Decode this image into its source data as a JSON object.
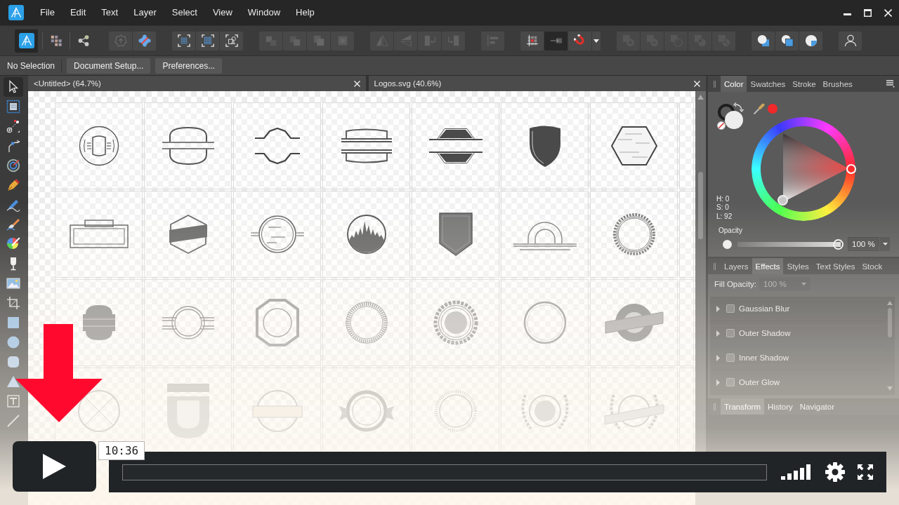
{
  "menu_bar": {
    "items": [
      "File",
      "Edit",
      "Text",
      "Layer",
      "Select",
      "View",
      "Window",
      "Help"
    ]
  },
  "toolbar": {
    "groups": [
      {
        "buttons": [
          {
            "selected": true,
            "disabled": false
          },
          {
            "selected": false,
            "disabled": false
          },
          {
            "selected": false,
            "disabled": false
          }
        ]
      },
      {
        "buttons": [
          {
            "selected": false,
            "disabled": true
          },
          {
            "selected": false,
            "disabled": false
          }
        ]
      },
      {
        "buttons": [
          {
            "selected": false,
            "disabled": false
          },
          {
            "selected": false,
            "disabled": false
          },
          {
            "selected": false,
            "disabled": false
          }
        ]
      },
      {
        "buttons": [
          {
            "selected": false,
            "disabled": true
          },
          {
            "selected": false,
            "disabled": true
          },
          {
            "selected": false,
            "disabled": true
          },
          {
            "selected": false,
            "disabled": true
          }
        ]
      },
      {
        "buttons": [
          {
            "selected": false,
            "disabled": true
          },
          {
            "selected": false,
            "disabled": true
          },
          {
            "selected": false,
            "disabled": true
          },
          {
            "selected": false,
            "disabled": true
          }
        ]
      },
      {
        "buttons": [
          {
            "selected": false,
            "disabled": true
          }
        ]
      },
      {
        "buttons": [
          {
            "selected": false,
            "disabled": false
          },
          {
            "selected": true,
            "disabled": false
          },
          {
            "selected": false,
            "disabled": false
          },
          {
            "selected": false,
            "disabled": false
          }
        ]
      },
      {
        "buttons": [
          {
            "selected": false,
            "disabled": true
          },
          {
            "selected": false,
            "disabled": true
          },
          {
            "selected": false,
            "disabled": true
          },
          {
            "selected": false,
            "disabled": true
          },
          {
            "selected": false,
            "disabled": true
          }
        ]
      },
      {
        "buttons": [
          {
            "selected": false,
            "disabled": false
          },
          {
            "selected": false,
            "disabled": false
          },
          {
            "selected": false,
            "disabled": false
          }
        ]
      },
      {
        "buttons": [
          {
            "selected": false,
            "disabled": false
          }
        ]
      }
    ]
  },
  "context_bar": {
    "status": "No Selection",
    "buttons": [
      "Document Setup...",
      "Preferences..."
    ]
  },
  "tools": [
    {
      "selected": true
    },
    {
      "selected": false
    },
    {
      "selected": false
    },
    {
      "selected": false
    },
    {
      "selected": false
    },
    {
      "selected": false
    },
    {
      "selected": false
    },
    {
      "selected": false
    },
    {
      "selected": false
    },
    {
      "selected": false
    },
    {
      "selected": false
    },
    {
      "selected": false
    },
    {
      "selected": false
    },
    {
      "selected": false
    },
    {
      "selected": false
    },
    {
      "selected": false
    },
    {
      "selected": false
    },
    {
      "selected": false
    }
  ],
  "documents": [
    {
      "title": "<Untitled> (64.7%)"
    },
    {
      "title": "Logos.svg (40.6%)"
    }
  ],
  "color_panel": {
    "tabs": [
      {
        "label": "Color",
        "selected": true
      },
      {
        "label": "Swatches",
        "selected": false
      },
      {
        "label": "Stroke",
        "selected": false
      },
      {
        "label": "Brushes",
        "selected": false
      }
    ],
    "readouts": [
      "H: 0",
      "S: 0",
      "L: 92"
    ],
    "opacity": {
      "label": "Opacity",
      "level": 1,
      "value": "100 %"
    }
  },
  "effects_panel": {
    "tabs": [
      {
        "label": "Layers",
        "selected": false
      },
      {
        "label": "Effects",
        "selected": true
      },
      {
        "label": "Styles",
        "selected": false
      },
      {
        "label": "Text Styles",
        "selected": false
      },
      {
        "label": "Stock",
        "selected": false
      }
    ],
    "fill_opacity": {
      "label": "Fill Opacity:",
      "value": "100 %",
      "disabled": true
    },
    "effects": [
      {
        "label": "Gaussian Blur",
        "expanded": false,
        "checked": false
      },
      {
        "label": "Outer Shadow",
        "expanded": false,
        "checked": false
      },
      {
        "label": "Inner Shadow",
        "expanded": false,
        "checked": false
      },
      {
        "label": "Outer Glow",
        "expanded": false,
        "checked": false
      }
    ]
  },
  "bottom_panel": {
    "tabs": [
      {
        "label": "Transform",
        "selected": true
      },
      {
        "label": "History",
        "selected": false
      },
      {
        "label": "Navigator",
        "selected": false
      }
    ]
  },
  "player": {
    "time": "10:36"
  }
}
